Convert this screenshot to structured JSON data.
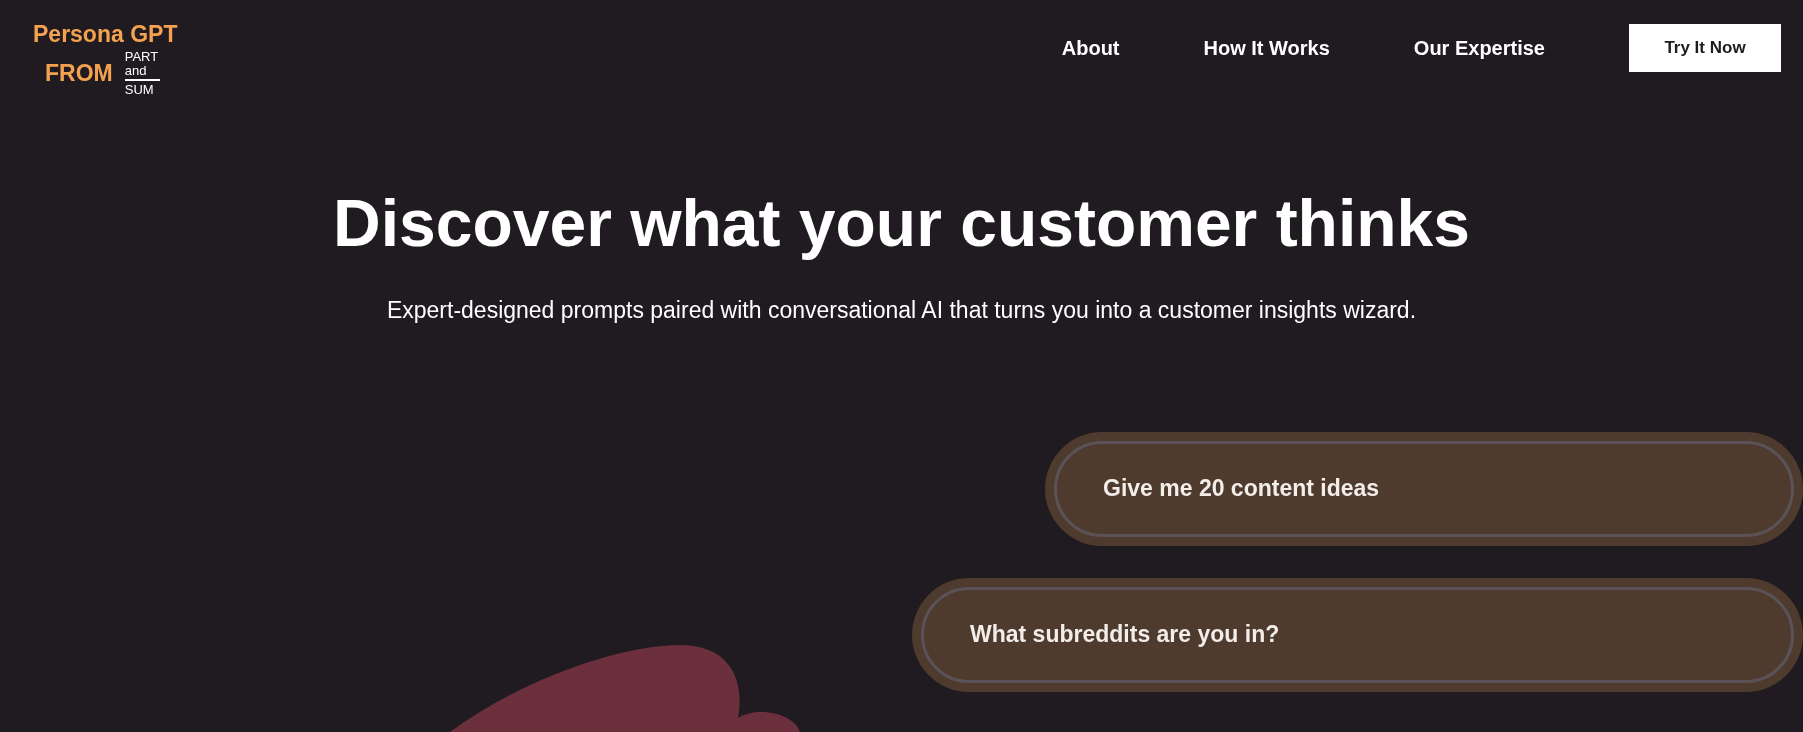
{
  "logo": {
    "title": "Persona GPT",
    "from": "FROM",
    "brand_top": "PART",
    "brand_middle": "and",
    "brand_bottom": "SUM"
  },
  "nav": {
    "links": [
      "About",
      "How It Works",
      "Our Expertise"
    ],
    "cta": "Try It Now"
  },
  "hero": {
    "headline": "Discover what your customer thinks",
    "subtitle": "Expert-designed prompts paired with conversational AI that turns you into a customer insights wizard."
  },
  "prompts": [
    "Give me 20 content ideas",
    "What subreddits are you in?"
  ]
}
